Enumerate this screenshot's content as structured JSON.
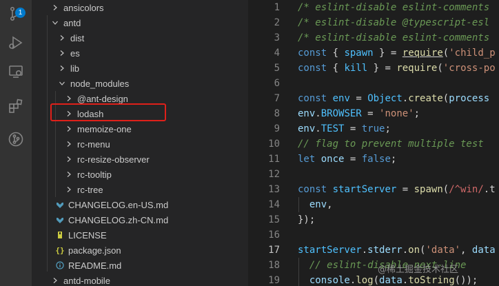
{
  "activity_bar": {
    "source_control_badge": "1"
  },
  "explorer": {
    "items": [
      {
        "label": "ansicolors",
        "kind": "folder",
        "expanded": false
      },
      {
        "label": "antd",
        "kind": "folder",
        "expanded": true
      },
      {
        "label": "dist",
        "kind": "folder",
        "expanded": false
      },
      {
        "label": "es",
        "kind": "folder",
        "expanded": false
      },
      {
        "label": "lib",
        "kind": "folder",
        "expanded": false
      },
      {
        "label": "node_modules",
        "kind": "folder",
        "expanded": true
      },
      {
        "label": "@ant-design",
        "kind": "folder",
        "expanded": false
      },
      {
        "label": "lodash",
        "kind": "folder",
        "expanded": false
      },
      {
        "label": "memoize-one",
        "kind": "folder",
        "expanded": false
      },
      {
        "label": "rc-menu",
        "kind": "folder",
        "expanded": false
      },
      {
        "label": "rc-resize-observer",
        "kind": "folder",
        "expanded": false
      },
      {
        "label": "rc-tooltip",
        "kind": "folder",
        "expanded": false
      },
      {
        "label": "rc-tree",
        "kind": "folder",
        "expanded": false
      },
      {
        "label": "CHANGELOG.en-US.md",
        "kind": "markdown"
      },
      {
        "label": "CHANGELOG.zh-CN.md",
        "kind": "markdown"
      },
      {
        "label": "LICENSE",
        "kind": "license"
      },
      {
        "label": "package.json",
        "kind": "json"
      },
      {
        "label": "README.md",
        "kind": "info"
      },
      {
        "label": "antd-mobile",
        "kind": "folder",
        "expanded": false
      }
    ],
    "highlighted_item": "lodash"
  },
  "editor": {
    "active_line": "17",
    "lines": [
      {
        "n": "1",
        "tokens": [
          [
            "/* eslint-disable eslint-comments",
            "c-comment"
          ]
        ]
      },
      {
        "n": "2",
        "tokens": [
          [
            "/* eslint-disable @typescript-esl",
            "c-comment"
          ]
        ]
      },
      {
        "n": "3",
        "tokens": [
          [
            "/* eslint-disable eslint-comments",
            "c-comment"
          ]
        ]
      },
      {
        "n": "4",
        "tokens": [
          [
            "const",
            "c-kw"
          ],
          [
            " { ",
            "c-plain"
          ],
          [
            "spawn",
            "c-const"
          ],
          [
            " } = ",
            "c-plain"
          ],
          [
            "require",
            "c-fn underline"
          ],
          [
            "(",
            "c-plain"
          ],
          [
            "'child_p",
            "c-str"
          ]
        ]
      },
      {
        "n": "5",
        "tokens": [
          [
            "const",
            "c-kw"
          ],
          [
            " { ",
            "c-plain"
          ],
          [
            "kill",
            "c-const"
          ],
          [
            " } = ",
            "c-plain"
          ],
          [
            "require",
            "c-fn"
          ],
          [
            "(",
            "c-plain"
          ],
          [
            "'cross-po",
            "c-str"
          ]
        ]
      },
      {
        "n": "6",
        "tokens": []
      },
      {
        "n": "7",
        "tokens": [
          [
            "const",
            "c-kw"
          ],
          [
            " ",
            "c-plain"
          ],
          [
            "env",
            "c-const"
          ],
          [
            " = ",
            "c-plain"
          ],
          [
            "Object",
            "c-const"
          ],
          [
            ".",
            "c-plain"
          ],
          [
            "create",
            "c-fn"
          ],
          [
            "(",
            "c-plain"
          ],
          [
            "process",
            "c-var"
          ]
        ]
      },
      {
        "n": "8",
        "tokens": [
          [
            "env",
            "c-var"
          ],
          [
            ".",
            "c-plain"
          ],
          [
            "BROWSER",
            "c-const"
          ],
          [
            " = ",
            "c-plain"
          ],
          [
            "'none'",
            "c-str"
          ],
          [
            ";",
            "c-plain"
          ]
        ]
      },
      {
        "n": "9",
        "tokens": [
          [
            "env",
            "c-var"
          ],
          [
            ".",
            "c-plain"
          ],
          [
            "TEST",
            "c-const"
          ],
          [
            " = ",
            "c-plain"
          ],
          [
            "true",
            "c-kw"
          ],
          [
            ";",
            "c-plain"
          ]
        ]
      },
      {
        "n": "10",
        "tokens": [
          [
            "// flag to prevent multiple test",
            "c-comment"
          ]
        ]
      },
      {
        "n": "11",
        "tokens": [
          [
            "let",
            "c-kw"
          ],
          [
            " ",
            "c-plain"
          ],
          [
            "once",
            "c-var"
          ],
          [
            " = ",
            "c-plain"
          ],
          [
            "false",
            "c-kw"
          ],
          [
            ";",
            "c-plain"
          ]
        ]
      },
      {
        "n": "12",
        "tokens": []
      },
      {
        "n": "13",
        "tokens": [
          [
            "const",
            "c-kw"
          ],
          [
            " ",
            "c-plain"
          ],
          [
            "startServer",
            "c-const"
          ],
          [
            " = ",
            "c-plain"
          ],
          [
            "spawn",
            "c-fn"
          ],
          [
            "(",
            "c-plain"
          ],
          [
            "/^win/",
            "c-regex"
          ],
          [
            ".t",
            "c-plain"
          ]
        ]
      },
      {
        "n": "14",
        "tokens": [
          [
            "  ",
            "c-plain"
          ],
          [
            "env",
            "c-var"
          ],
          [
            ",",
            "c-plain"
          ]
        ]
      },
      {
        "n": "15",
        "tokens": [
          [
            "});",
            "c-plain"
          ]
        ]
      },
      {
        "n": "16",
        "tokens": []
      },
      {
        "n": "17",
        "tokens": [
          [
            "startServer",
            "c-const"
          ],
          [
            ".",
            "c-plain"
          ],
          [
            "stderr",
            "c-var"
          ],
          [
            ".",
            "c-plain"
          ],
          [
            "on",
            "c-fn"
          ],
          [
            "(",
            "c-plain"
          ],
          [
            "'data'",
            "c-str"
          ],
          [
            ", ",
            "c-plain"
          ],
          [
            "data",
            "c-var"
          ]
        ]
      },
      {
        "n": "18",
        "tokens": [
          [
            "  ",
            "c-plain"
          ],
          [
            "// eslint-disable-next-line",
            "c-comment"
          ]
        ]
      },
      {
        "n": "19",
        "tokens": [
          [
            "  ",
            "c-plain"
          ],
          [
            "console",
            "c-var"
          ],
          [
            ".",
            "c-plain"
          ],
          [
            "log",
            "c-fn"
          ],
          [
            "(",
            "c-plain"
          ],
          [
            "data",
            "c-var"
          ],
          [
            ".",
            "c-plain"
          ],
          [
            "toString",
            "c-fn"
          ],
          [
            "());",
            "c-plain"
          ]
        ]
      }
    ]
  },
  "watermark": "@稀土掘金技术社区",
  "colors": {
    "highlight_box": "#e0201a",
    "badge": "#007acc"
  }
}
